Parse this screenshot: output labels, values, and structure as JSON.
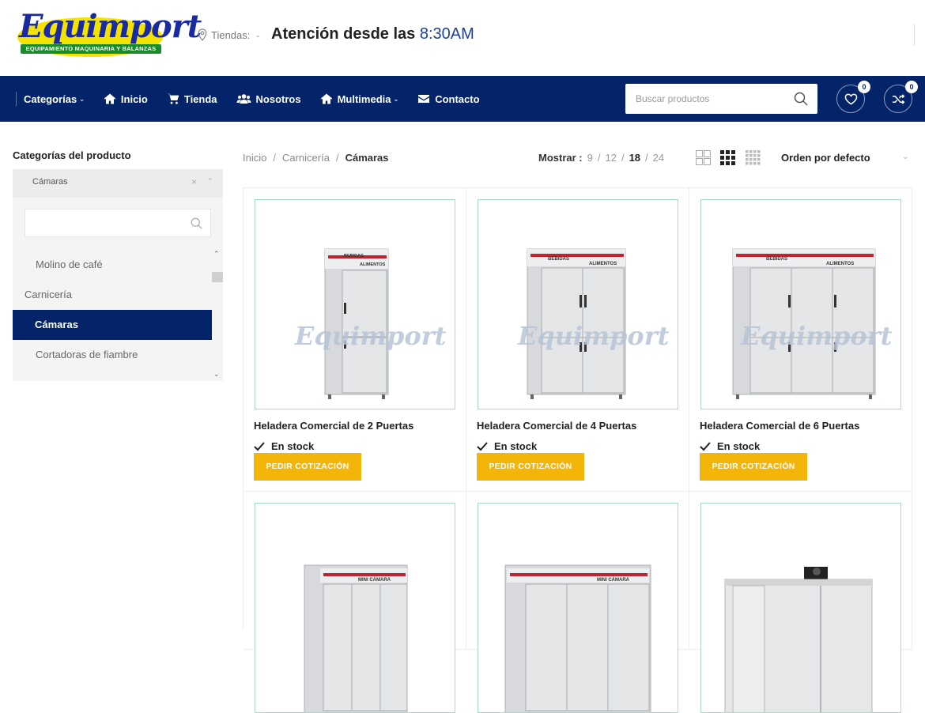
{
  "header": {
    "logo": {
      "word": "Equimport",
      "tagline": "EQUIPAMIENTO MAQUINARIA Y BALANZAS"
    },
    "stores_label": "Tiendas:",
    "attention_text": "Atención desde las",
    "attention_time": "8:30AM"
  },
  "nav": {
    "items": [
      {
        "label": "Categorías",
        "icon": "none",
        "dropdown": true
      },
      {
        "label": "Inicio",
        "icon": "home-icon"
      },
      {
        "label": "Tienda",
        "icon": "cart-icon"
      },
      {
        "label": "Nosotros",
        "icon": "users-icon"
      },
      {
        "label": "Multimedia",
        "icon": "home-icon",
        "dropdown": true
      },
      {
        "label": "Contacto",
        "icon": "envelope-icon"
      }
    ],
    "search_placeholder": "Buscar productos",
    "wishlist_count": "0",
    "compare_count": "0"
  },
  "sidebar": {
    "title": "Categorías del producto",
    "selected": "Cámaras",
    "categories": [
      {
        "label": "Molino de café",
        "level": "sub"
      },
      {
        "label": "Carnicería",
        "level": "top"
      },
      {
        "label": "Cámaras",
        "level": "active"
      },
      {
        "label": "Cortadoras de fiambre",
        "level": "sub"
      }
    ]
  },
  "toolbar": {
    "breadcrumb": [
      "Inicio",
      "Carnicería",
      "Cámaras"
    ],
    "show_label": "Mostrar :",
    "show_options": [
      "9",
      "12",
      "18",
      "24"
    ],
    "show_selected": "18",
    "order_label": "Orden por defecto"
  },
  "products": [
    {
      "name": "Heladera Comercial de 2 Puertas",
      "stock": "En stock",
      "button": "PEDIR COTIZACIÓN",
      "doors": 2
    },
    {
      "name": "Heladera Comercial de 4 Puertas",
      "stock": "En stock",
      "button": "PEDIR COTIZACIÓN",
      "doors": 4
    },
    {
      "name": "Heladera Comercial de 6 Puertas",
      "stock": "En stock",
      "button": "PEDIR COTIZACIÓN",
      "doors": 6
    },
    {
      "doors": 3
    },
    {
      "doors": 3
    },
    {
      "doors": 0
    }
  ],
  "image_labels": {
    "bebidas": "BEBIDAS",
    "alimentos": "ALIMENTOS",
    "mini": "MINI CÁMARA",
    "watermark": "Equimport"
  },
  "colors": {
    "navy": "#032468",
    "yellow": "#f3b509",
    "accent_blue": "#1a3fa0",
    "frame_green": "#a5dcc8"
  }
}
